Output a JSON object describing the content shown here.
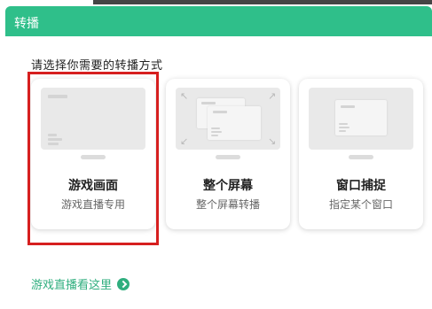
{
  "window": {
    "title": "转播"
  },
  "prompt": "请选择你需要的转播方式",
  "cards": [
    {
      "name": "游戏画面",
      "desc": "游戏直播专用",
      "selected": true
    },
    {
      "name": "整个屏幕",
      "desc": "整个屏幕转播"
    },
    {
      "name": "窗口捕捉",
      "desc": "指定某个窗口"
    }
  ],
  "footer": {
    "link_label": "游戏直播看这里"
  },
  "colors": {
    "accent": "#2fbf8a",
    "highlight": "#d61f1f",
    "link": "#2fae7e"
  },
  "icons": {
    "game": "game-screen-icon",
    "fullscreen": "fullscreen-icon",
    "window": "window-capture-icon",
    "link": "arrow-circle-icon"
  }
}
